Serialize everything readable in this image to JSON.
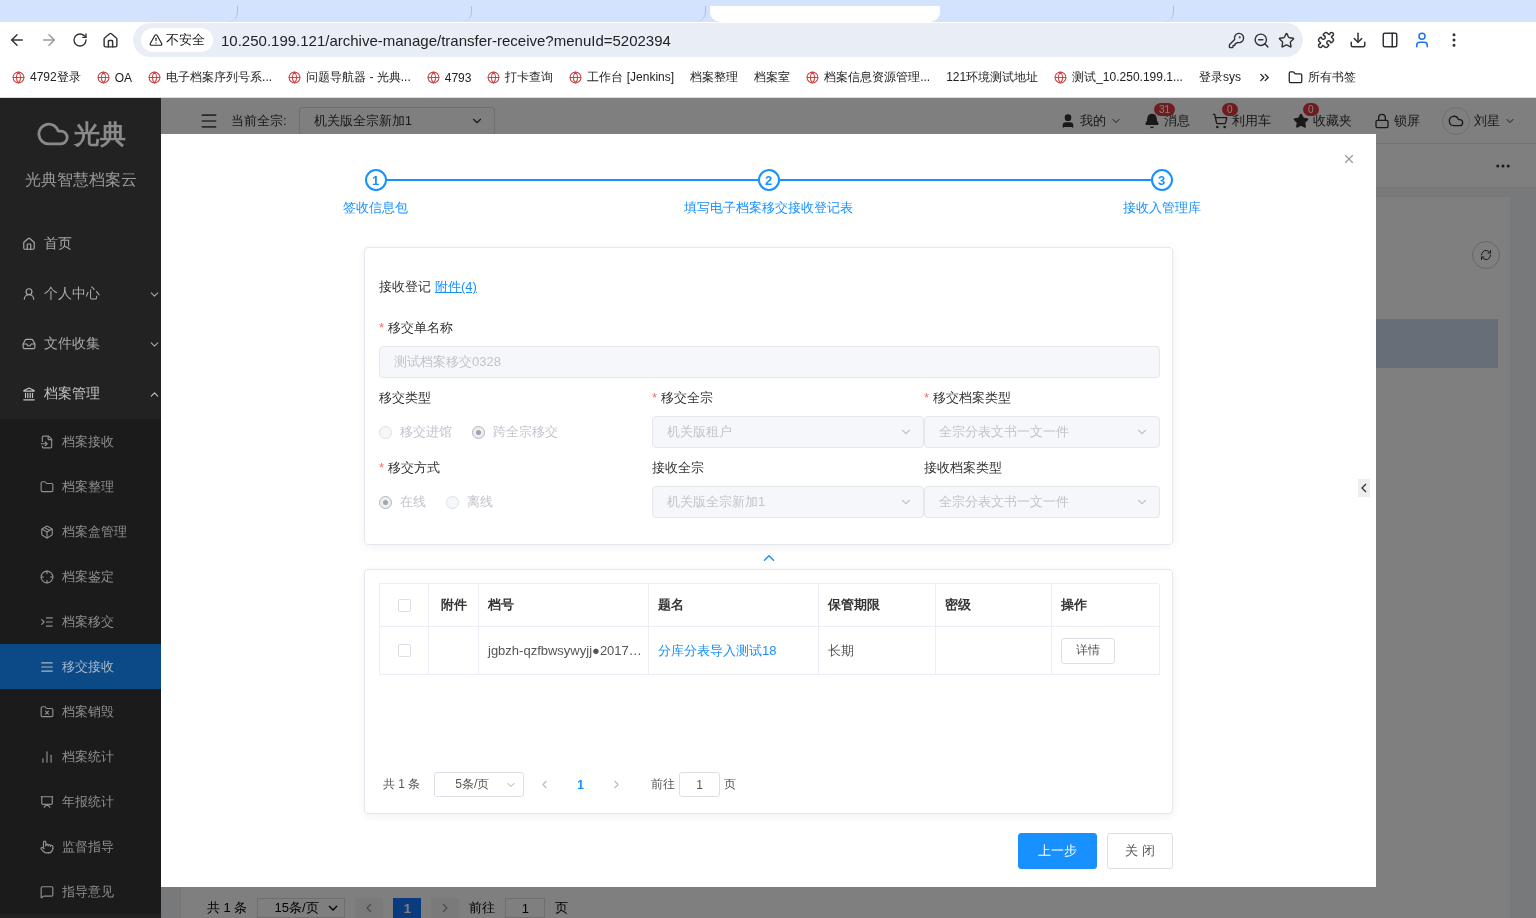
{
  "browser": {
    "tabs": [
      {
        "selected": false
      },
      {
        "selected": false
      },
      {
        "selected": false
      },
      {
        "selected": true
      },
      {
        "selected": false
      }
    ],
    "address": {
      "security_label": "不安全",
      "url": "10.250.199.121/archive-manage/transfer-receive?menuId=5202394"
    },
    "bookmarks": [
      {
        "label": "4792登录",
        "icon": true
      },
      {
        "label": "OA",
        "icon": true
      },
      {
        "label": "电子档案序列号系...",
        "icon": true
      },
      {
        "label": "问题导航器 - 光典...",
        "icon": true
      },
      {
        "label": "4793",
        "icon": true
      },
      {
        "label": "打卡查询",
        "icon": true
      },
      {
        "label": "工作台 [Jenkins]",
        "icon": true
      },
      {
        "label": "档案整理",
        "icon": false
      },
      {
        "label": "档案室",
        "icon": false
      },
      {
        "label": "档案信息资源管理...",
        "icon": true
      },
      {
        "label": "121环境测试地址",
        "icon": false
      },
      {
        "label": "测试_10.250.199.1...",
        "icon": true
      },
      {
        "label": "登录sys",
        "icon": false
      }
    ],
    "all_bookmarks": "所有书签"
  },
  "app": {
    "logo_text": "光典",
    "product_name": "光典智慧档案云",
    "sidebar": {
      "items": [
        {
          "label": "首页",
          "kind": "link"
        },
        {
          "label": "个人中心",
          "kind": "submenu",
          "expanded": false
        },
        {
          "label": "文件收集",
          "kind": "submenu",
          "expanded": false
        },
        {
          "label": "档案管理",
          "kind": "submenu",
          "expanded": true,
          "children": [
            {
              "label": "档案接收",
              "selected": false
            },
            {
              "label": "档案整理",
              "selected": false
            },
            {
              "label": "档案盒管理",
              "selected": false
            },
            {
              "label": "档案鉴定",
              "selected": false
            },
            {
              "label": "档案移交",
              "selected": false
            },
            {
              "label": "移交接收",
              "selected": true
            },
            {
              "label": "档案销毁",
              "selected": false
            },
            {
              "label": "档案统计",
              "selected": false
            },
            {
              "label": "年报统计",
              "selected": false
            },
            {
              "label": "监督指导",
              "selected": false
            },
            {
              "label": "指导意见",
              "selected": false
            }
          ]
        }
      ]
    },
    "header": {
      "fonds_label": "当前全宗:",
      "fonds_value": "机关版全宗新加1",
      "actions": [
        {
          "kind": "user",
          "label": "我的"
        },
        {
          "kind": "bell",
          "label": "消息",
          "badge": "31"
        },
        {
          "kind": "cart",
          "label": "利用车",
          "badge": "0"
        },
        {
          "kind": "star",
          "label": "收藏夹",
          "badge": "0"
        },
        {
          "kind": "lock",
          "label": "锁屏"
        }
      ],
      "user_name": "刘星"
    },
    "background_pagination": {
      "total": "共 1 条",
      "page_size": "15条/页",
      "pages": [
        {
          "label": "1",
          "selected": true
        }
      ],
      "goto_label": "前往",
      "goto_value": "1",
      "page_suffix": "页"
    }
  },
  "dialog": {
    "steps": [
      {
        "number": "1",
        "label": "签收信息包",
        "active": true
      },
      {
        "number": "2",
        "label": "填写电子档案移交接收登记表",
        "active": true
      },
      {
        "number": "3",
        "label": "接收入管理库",
        "active": true
      }
    ],
    "form": {
      "title": "接收登记",
      "required_mark": "*",
      "attachment_link": "附件(4)",
      "fields": [
        {
          "kind": "text",
          "label": "移交单名称",
          "required": true,
          "value": "测试档案移交0328",
          "disabled": true
        },
        {
          "kind": "radio",
          "label": "移交类型",
          "required": false,
          "disabled": true,
          "options": [
            {
              "label": "移交进馆",
              "selected": false
            },
            {
              "label": "跨全宗移交",
              "selected": true
            }
          ]
        },
        {
          "kind": "select",
          "label": "移交全宗",
          "required": true,
          "value": "机关版租户",
          "disabled": true
        },
        {
          "kind": "select",
          "label": "移交档案类型",
          "required": true,
          "value": "全宗分表文书一文一件",
          "disabled": true
        },
        {
          "kind": "radio",
          "label": "移交方式",
          "required": true,
          "disabled": true,
          "options": [
            {
              "label": "在线",
              "selected": true
            },
            {
              "label": "离线",
              "selected": false
            }
          ]
        },
        {
          "kind": "select",
          "label": "接收全宗",
          "required": false,
          "value": "机关版全宗新加1",
          "disabled": true
        },
        {
          "kind": "select",
          "label": "接收档案类型",
          "required": false,
          "value": "全宗分表文书一文一件",
          "disabled": true
        }
      ]
    },
    "table": {
      "header_checked": false,
      "columns": [
        "附件",
        "档号",
        "题名",
        "保管期限",
        "密级",
        "操作"
      ],
      "rows": [
        {
          "checked": false,
          "attachment": "",
          "archive_no": "jgbzh-qzfbwsywyjj●2017…",
          "title": "分库分表导入测试18",
          "retention": "长期",
          "security": "",
          "action": "详情"
        }
      ]
    },
    "pagination": {
      "total": "共 1 条",
      "page_size": "5条/页",
      "pages": [
        {
          "label": "1",
          "selected": true
        }
      ],
      "goto_label": "前往",
      "goto_value": "1",
      "page_suffix": "页"
    },
    "buttons": [
      {
        "kind": "primary",
        "label": "上一步"
      },
      {
        "kind": "default",
        "label": "关 闭"
      }
    ]
  }
}
